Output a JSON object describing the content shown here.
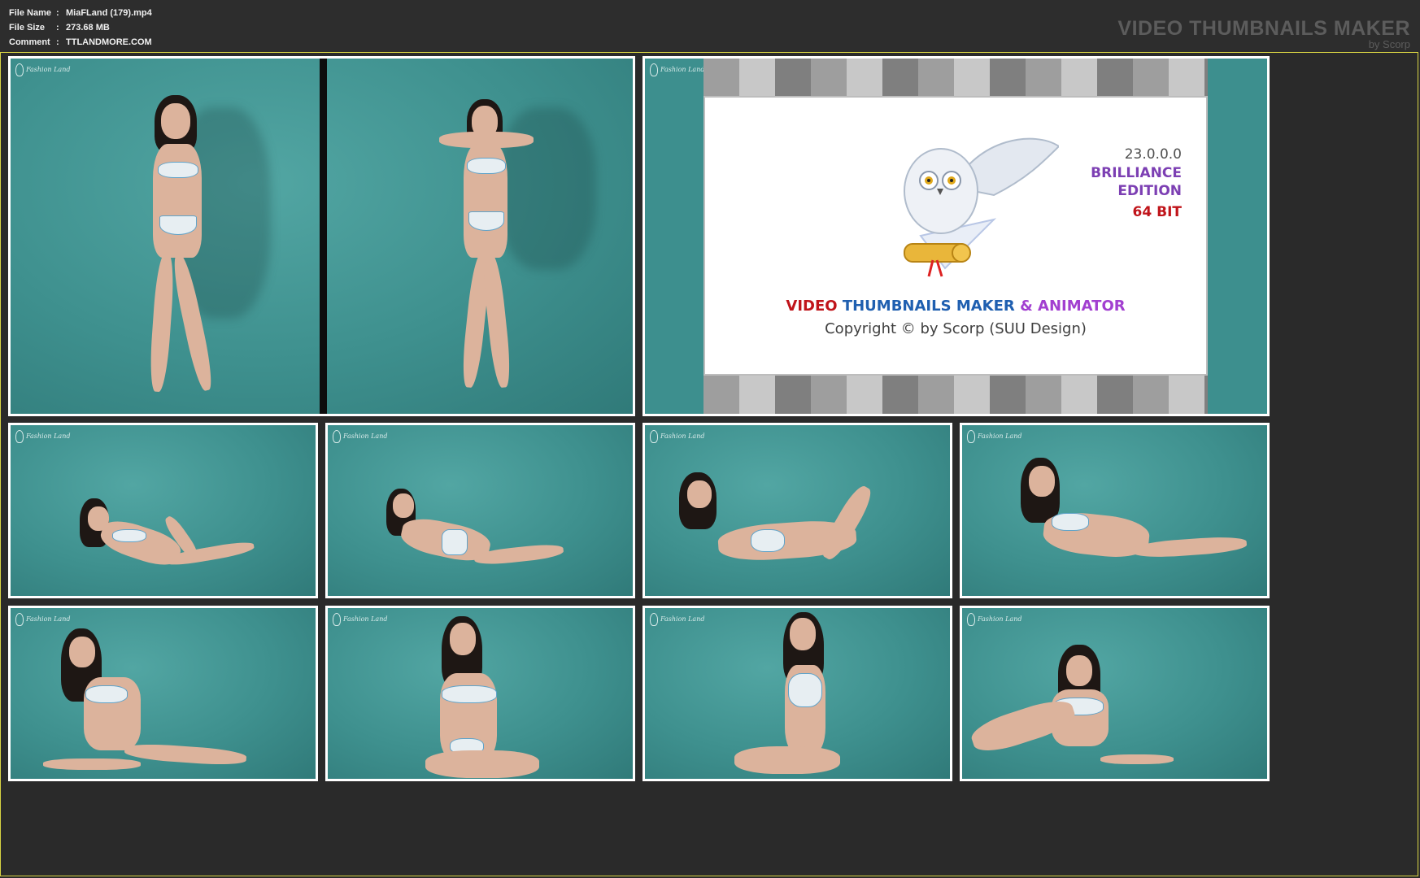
{
  "info": {
    "rows": [
      {
        "label": "File Name",
        "sep": ":",
        "value": "MiaFLand (179).mp4"
      },
      {
        "label": "File Size",
        "sep": ":",
        "value": "273.68 MB"
      },
      {
        "label": "Comment",
        "sep": ":",
        "value": "TTLANDMORE.COM"
      }
    ]
  },
  "brand": {
    "title": "VIDEO THUMBNAILS MAKER",
    "subtitle": "by Scorp"
  },
  "splash": {
    "version": "23.0.0.0",
    "edition_line1": "BRILLIANCE",
    "edition_line2": "EDITION",
    "bits": "64 BIT",
    "product_part1": "VIDEO",
    "product_part2": "THUMBNAILS MAKER",
    "product_part3": "& ANIMATOR",
    "copyright": "Copyright © by Scorp (SUU Design)"
  },
  "thumbnails": [
    {
      "id": "thumb-1",
      "subject": "model standing, two poses"
    },
    {
      "id": "thumb-2",
      "subject": "software splash screen"
    },
    {
      "id": "thumb-3",
      "subject": "model reclining"
    },
    {
      "id": "thumb-4",
      "subject": "model lying on side"
    },
    {
      "id": "thumb-5",
      "subject": "model lying on stomach"
    },
    {
      "id": "thumb-6",
      "subject": "model lying on side"
    },
    {
      "id": "thumb-7",
      "subject": "model sitting"
    },
    {
      "id": "thumb-8",
      "subject": "model sitting"
    },
    {
      "id": "thumb-9",
      "subject": "model kneeling"
    },
    {
      "id": "thumb-10",
      "subject": "model sitting"
    }
  ],
  "colors": {
    "background": "#2b2b2b",
    "accent_border": "#d7d243",
    "studio_teal": "#3d8f8e"
  }
}
